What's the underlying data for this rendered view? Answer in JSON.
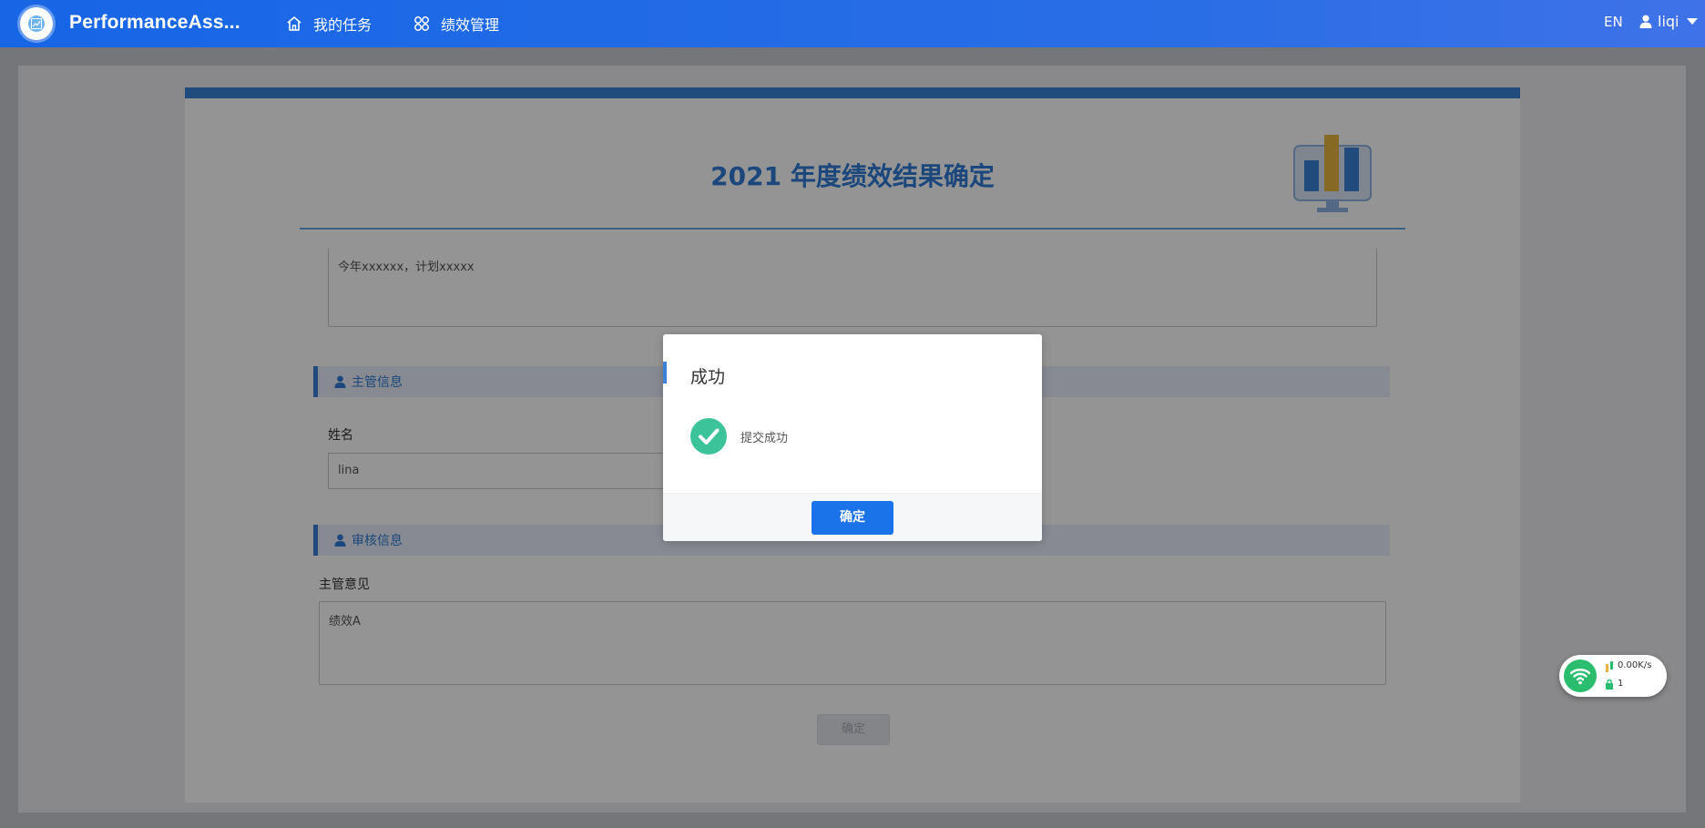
{
  "header": {
    "app_name": "PerformanceAss...",
    "nav": [
      {
        "label": "我的任务",
        "icon": "home-icon"
      },
      {
        "label": "绩效管理",
        "icon": "grid-icon"
      }
    ],
    "language": "EN",
    "username": "liqi"
  },
  "page": {
    "title": "2021 年度绩效结果确定",
    "summary_text": "今年xxxxxx，计划xxxxx",
    "sections": {
      "manager_info": {
        "title": "主管信息",
        "icon": "user-icon"
      },
      "review_info": {
        "title": "审核信息",
        "icon": "user-icon"
      }
    },
    "name_label": "姓名",
    "name_value": "lina",
    "opinion_label": "主管意见",
    "opinion_value": "绩效A",
    "confirm_label": "确定"
  },
  "modal": {
    "title": "成功",
    "message": "提交成功",
    "ok_label": "确定",
    "icon": "check-circle-icon"
  },
  "network_widget": {
    "speed": "0.00K/s",
    "count": "1"
  },
  "colors": {
    "primary": "#1a73e8",
    "accent_blue": "#3b82d8",
    "success_green": "#3cc39a",
    "chart_gold": "#e6b53f"
  }
}
